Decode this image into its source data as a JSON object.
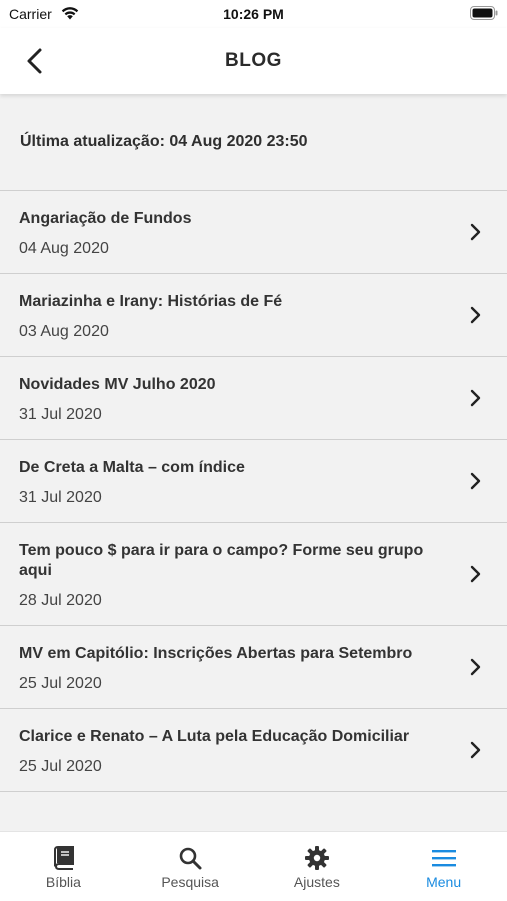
{
  "status_bar": {
    "carrier": "Carrier",
    "time": "10:26 PM"
  },
  "header": {
    "title": "BLOG",
    "back_icon": "chevron-left-icon"
  },
  "last_update": "Última atualização: 04 Aug 2020 23:50",
  "posts": [
    {
      "title": "Angariação de Fundos",
      "date": "04 Aug 2020"
    },
    {
      "title": "Mariazinha e Irany: Histórias de Fé",
      "date": "03 Aug 2020"
    },
    {
      "title": "Novidades MV Julho 2020",
      "date": "31 Jul 2020"
    },
    {
      "title": "De Creta a Malta – com índice",
      "date": "31 Jul 2020"
    },
    {
      "title": "Tem pouco $ para ir para o campo? Forme seu grupo aqui",
      "date": "28 Jul 2020"
    },
    {
      "title": "MV em Capitólio: Inscrições Abertas para Setembro",
      "date": "25 Jul 2020"
    },
    {
      "title": "Clarice e Renato – A Luta pela Educação Domiciliar",
      "date": "25 Jul 2020"
    }
  ],
  "tabs": [
    {
      "label": "Bíblia",
      "icon": "book-icon"
    },
    {
      "label": "Pesquisa",
      "icon": "search-icon"
    },
    {
      "label": "Ajustes",
      "icon": "gear-icon"
    },
    {
      "label": "Menu",
      "icon": "menu-icon",
      "active": true
    }
  ],
  "colors": {
    "accent": "#1a8be0",
    "background": "#f2f2f2",
    "divider": "#cfcfcf"
  }
}
